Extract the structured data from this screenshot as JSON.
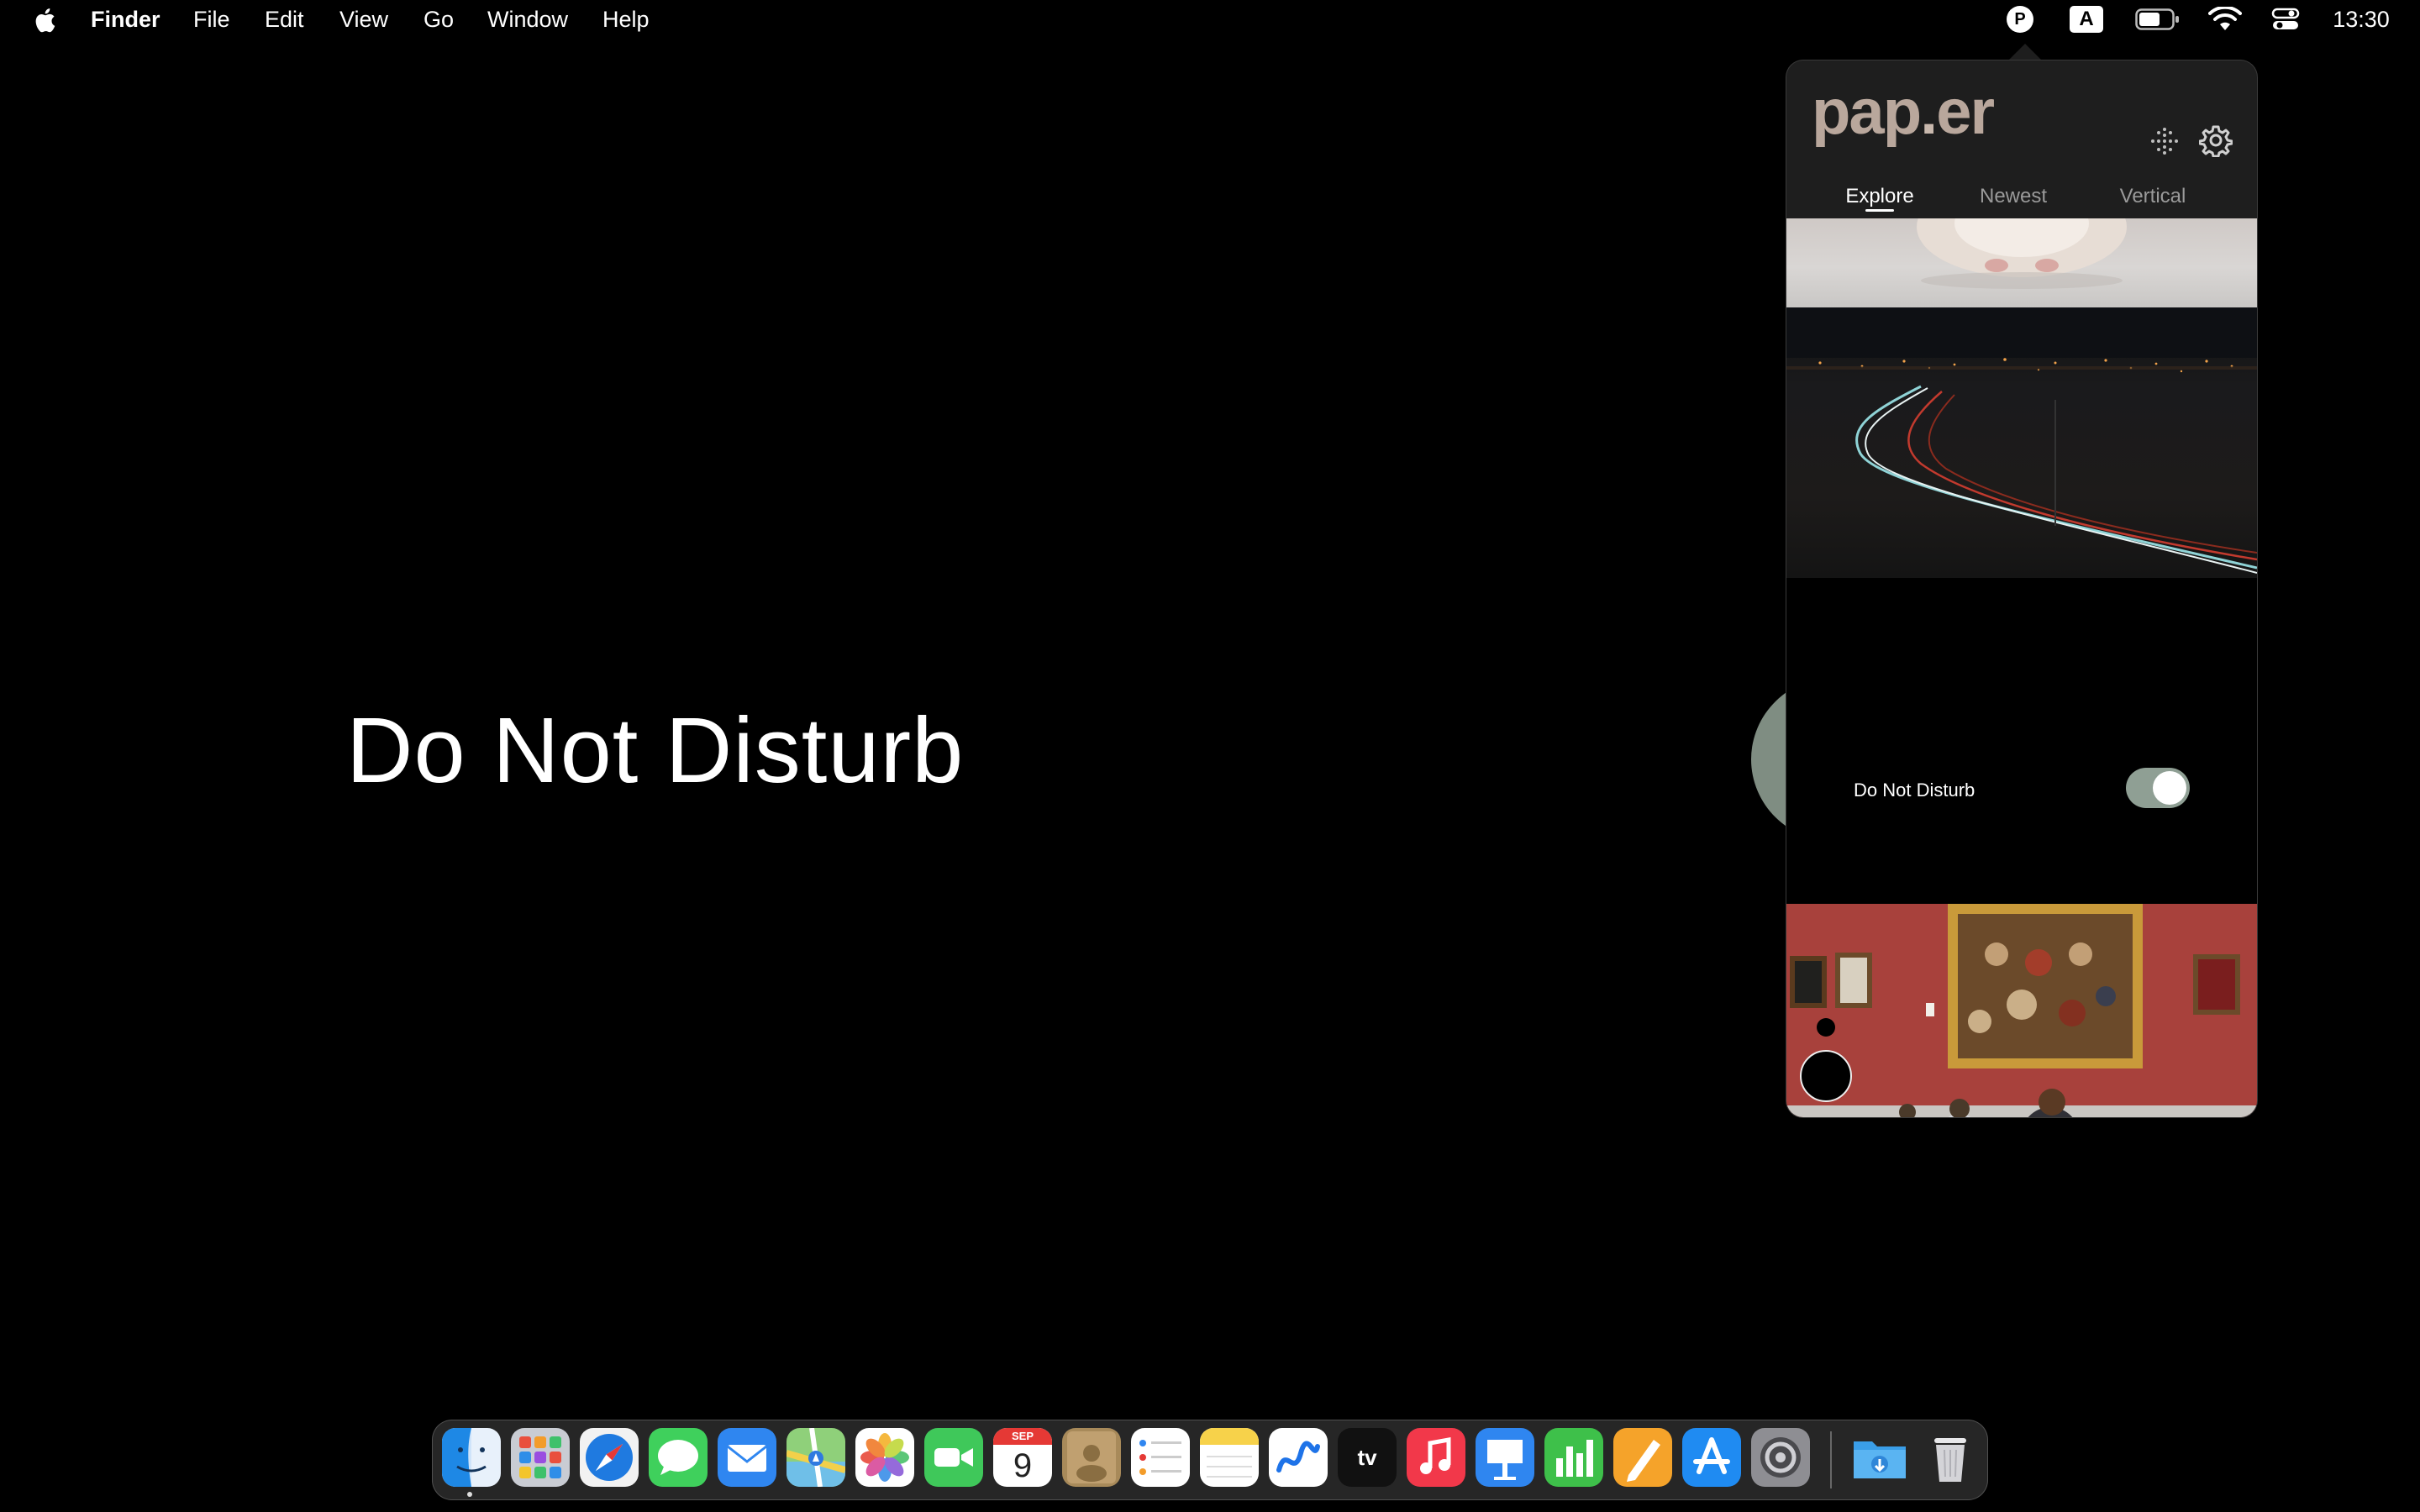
{
  "menubar": {
    "app_name": "Finder",
    "menus": [
      "File",
      "Edit",
      "View",
      "Go",
      "Window",
      "Help"
    ],
    "status": {
      "paper_icon_letter": "P",
      "input_source": "A",
      "clock": "13:30"
    }
  },
  "desktop": {
    "focus_title": "Do Not Disturb"
  },
  "popover": {
    "logo": {
      "main": "pap",
      "dot": ".",
      "end": "er"
    },
    "tabs": [
      "Explore",
      "Newest",
      "Vertical"
    ],
    "active_tab": "Explore",
    "dnd_label": "Do Not Disturb",
    "dnd_enabled": true
  },
  "dock": {
    "calendar": {
      "month": "SEP",
      "day": "9"
    },
    "tv_label": "tv",
    "apps": [
      "finder-icon",
      "launchpad-icon",
      "safari-icon",
      "messages-icon",
      "mail-icon",
      "maps-icon",
      "photos-icon",
      "facetime-icon",
      "calendar-icon",
      "contacts-icon",
      "reminders-icon",
      "notes-icon",
      "freeform-icon",
      "apple-tv-icon",
      "music-icon",
      "keynote-icon",
      "numbers-icon",
      "pages-icon",
      "app-store-icon",
      "system-settings-icon",
      "downloads-folder-icon",
      "trash-icon"
    ]
  },
  "colors": {
    "toggle_on": "#8f9f94",
    "logo": "#b9a79c",
    "popover_bg": "#1e1e1e",
    "museum_wall": "#a5403b"
  }
}
